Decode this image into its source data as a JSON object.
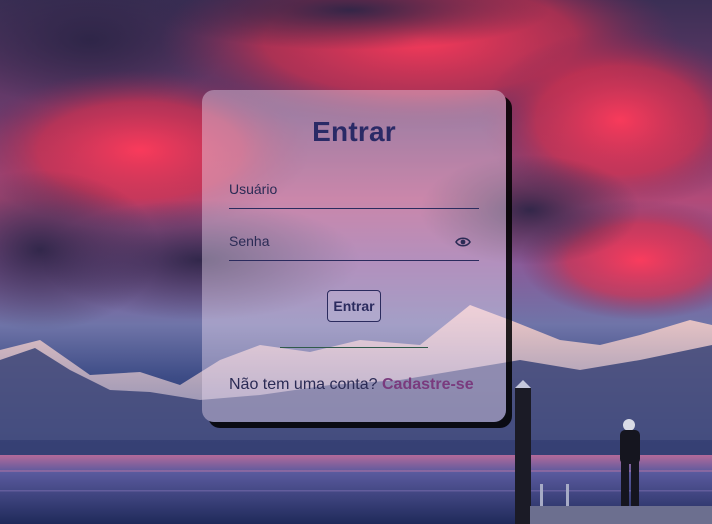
{
  "login_form": {
    "title": "Entrar",
    "username_label": "Usuário",
    "password_label": "Senha",
    "submit_label": "Entrar",
    "no_account_text": "Não tem uma conta?",
    "signup_link": "Cadastre-se",
    "password_toggle_icon": "eye-icon"
  },
  "colors": {
    "title": "#2a2a66",
    "link": "#7a3b7e",
    "field_line": "#2b2b5e"
  }
}
